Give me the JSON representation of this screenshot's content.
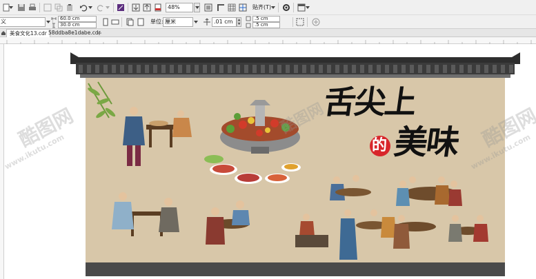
{
  "toolbar": {
    "zoom_value": "48%",
    "snap_label": "贴齐(T)",
    "width_value": "60.0 cm",
    "height_value": "30.0 cm",
    "units_label": "单位:",
    "units_value": "厘米",
    "nudge_value": ".01 cm",
    "dup_x_value": ".5 cm",
    "dup_y_value": ".5 cm",
    "paper_value": "义"
  },
  "tabs": [
    {
      "label": "美食文化13.cdr",
      "active": true
    },
    {
      "label": "58ddba8e1dabe.cdr",
      "active": false
    }
  ],
  "artwork": {
    "title_line1": "舌尖上",
    "title_char_de": "的",
    "title_line2": "美味"
  },
  "watermarks": {
    "logo": "酷图网",
    "url": "www.ikutu.com"
  },
  "colors": {
    "tile": "#3b3b3b",
    "wall_bg": "#dccdb0",
    "plinth": "#4a4a4a",
    "seal_red": "#d8262b"
  }
}
